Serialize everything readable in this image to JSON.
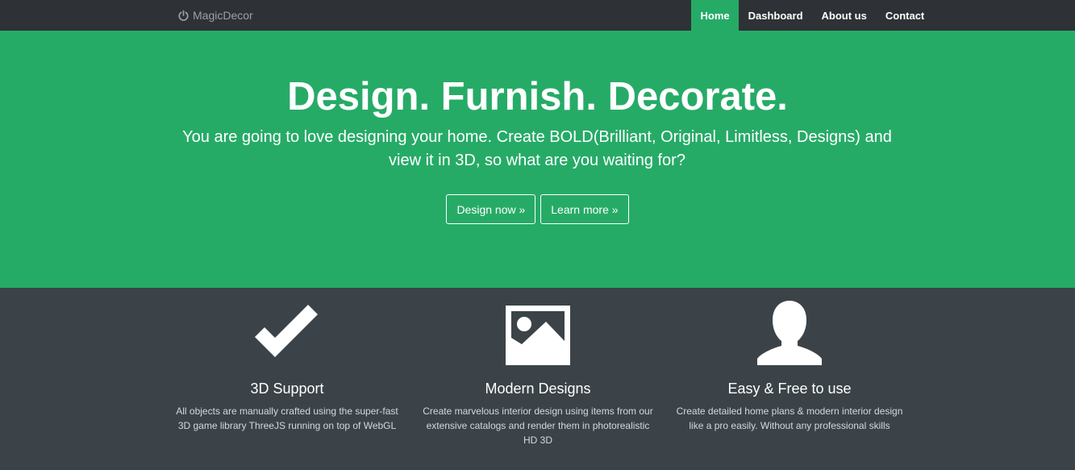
{
  "navbar": {
    "brand": "MagicDecor",
    "brand_icon": "power-icon",
    "items": [
      {
        "label": "Home",
        "active": true
      },
      {
        "label": "Dashboard",
        "active": false
      },
      {
        "label": "About us",
        "active": false
      },
      {
        "label": "Contact",
        "active": false
      }
    ]
  },
  "hero": {
    "title": "Design. Furnish. Decorate.",
    "subtitle": "You are going to love designing your home. Create BOLD(Brilliant, Original, Limitless, Designs) and view it in 3D, so what are you waiting for?",
    "buttons": [
      {
        "label": "Design now »"
      },
      {
        "label": "Learn more »"
      }
    ]
  },
  "features": [
    {
      "icon": "checkmark-icon",
      "title": "3D Support",
      "description": "All objects are manually crafted using the super-fast 3D game library ThreeJS running on top of WebGL"
    },
    {
      "icon": "image-icon",
      "title": "Modern Designs",
      "description": "Create marvelous interior design using items from our extensive catalogs and render them in photorealistic HD 3D"
    },
    {
      "icon": "user-icon",
      "title": "Easy & Free to use",
      "description": "Create detailed home plans & modern interior design like a pro easily. Without any professional skills"
    }
  ],
  "colors": {
    "navbar_bg": "#2e3135",
    "accent_green": "#26ab67",
    "features_bg": "#3b4348"
  }
}
